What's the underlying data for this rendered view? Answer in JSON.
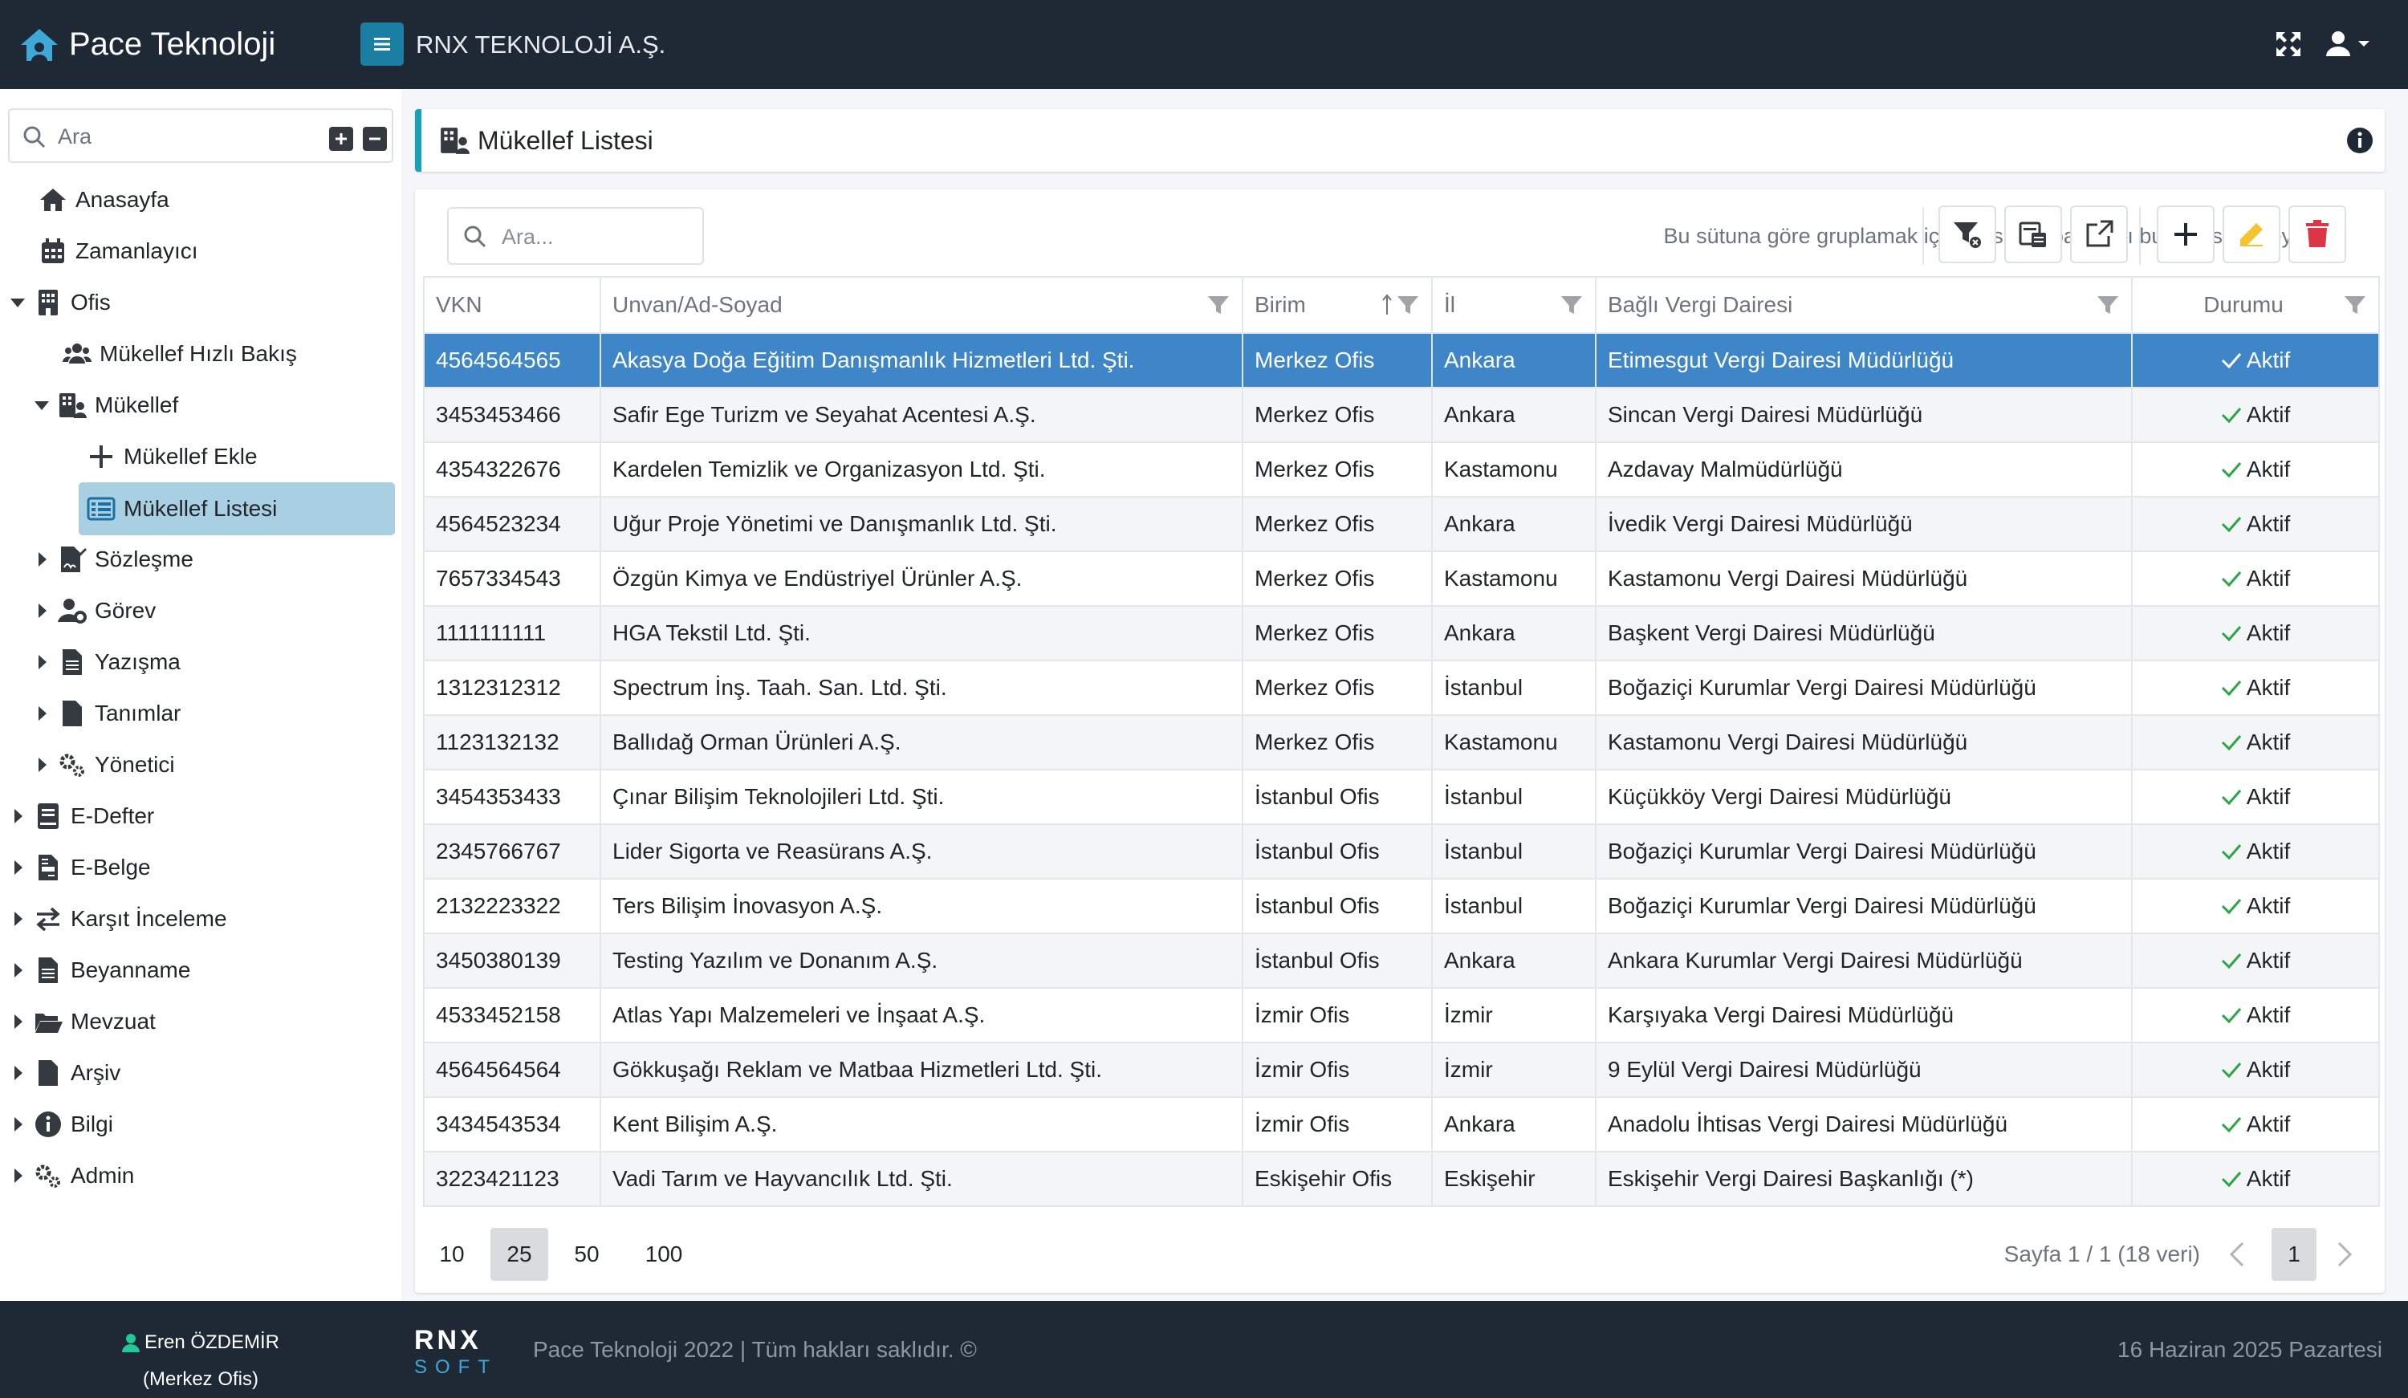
{
  "app": {
    "title": "Pace Teknoloji",
    "company": "RNX TEKNOLOJİ A.Ş."
  },
  "sidebar": {
    "search_placeholder": "Ara",
    "items": [
      {
        "label": "Anasayfa"
      },
      {
        "label": "Zamanlayıcı"
      },
      {
        "label": "Ofis"
      },
      {
        "label": "Mükellef Hızlı Bakış"
      },
      {
        "label": "Mükellef"
      },
      {
        "label": "Mükellef Ekle"
      },
      {
        "label": "Mükellef Listesi"
      },
      {
        "label": "Sözleşme"
      },
      {
        "label": "Görev"
      },
      {
        "label": "Yazışma"
      },
      {
        "label": "Tanımlar"
      },
      {
        "label": "Yönetici"
      },
      {
        "label": "E-Defter"
      },
      {
        "label": "E-Belge"
      },
      {
        "label": "Karşıt İnceleme"
      },
      {
        "label": "Beyanname"
      },
      {
        "label": "Mevzuat"
      },
      {
        "label": "Arşiv"
      },
      {
        "label": "Bilgi"
      },
      {
        "label": "Admin"
      }
    ]
  },
  "user": {
    "name": "Eren ÖZDEMİR",
    "office": "(Merkez Ofis)"
  },
  "footer": {
    "copyright": "Pace Teknoloji 2022 | Tüm hakları saklıdır. ©",
    "date": "16 Haziran 2025 Pazartesi",
    "logo_top": "RNX",
    "logo_bottom": "SOFT"
  },
  "page": {
    "title": "Mükellef Listesi"
  },
  "grid": {
    "search_placeholder": "Ara...",
    "group_hint": "Bu sütuna göre gruplamak için bir sütun başlığını buraya sürükleyin",
    "columns": [
      "VKN",
      "Unvan/Ad-Soyad",
      "Birim",
      "İl",
      "Bağlı Vergi Dairesi",
      "Durumu"
    ],
    "rows": [
      [
        "4564564565",
        "Akasya Doğa Eğitim Danışmanlık Hizmetleri Ltd. Şti.",
        "Merkez Ofis",
        "Ankara",
        "Etimesgut Vergi Dairesi Müdürlüğü",
        "Aktif"
      ],
      [
        "3453453466",
        "Safir Ege Turizm ve Seyahat Acentesi A.Ş.",
        "Merkez Ofis",
        "Ankara",
        "Sincan Vergi Dairesi Müdürlüğü",
        "Aktif"
      ],
      [
        "4354322676",
        "Kardelen Temizlik ve Organizasyon Ltd. Şti.",
        "Merkez Ofis",
        "Kastamonu",
        "Azdavay Malmüdürlüğü",
        "Aktif"
      ],
      [
        "4564523234",
        "Uğur Proje Yönetimi ve Danışmanlık Ltd. Şti.",
        "Merkez Ofis",
        "Ankara",
        "İvedik Vergi Dairesi Müdürlüğü",
        "Aktif"
      ],
      [
        "7657334543",
        "Özgün Kimya ve Endüstriyel Ürünler A.Ş.",
        "Merkez Ofis",
        "Kastamonu",
        "Kastamonu Vergi Dairesi Müdürlüğü",
        "Aktif"
      ],
      [
        "1111111111",
        "HGA Tekstil Ltd. Şti.",
        "Merkez Ofis",
        "Ankara",
        "Başkent Vergi Dairesi Müdürlüğü",
        "Aktif"
      ],
      [
        "1312312312",
        "Spectrum İnş. Taah. San. Ltd. Şti.",
        "Merkez Ofis",
        "İstanbul",
        "Boğaziçi Kurumlar Vergi Dairesi Müdürlüğü",
        "Aktif"
      ],
      [
        "1123132132",
        "Ballıdağ Orman Ürünleri A.Ş.",
        "Merkez Ofis",
        "Kastamonu",
        "Kastamonu Vergi Dairesi Müdürlüğü",
        "Aktif"
      ],
      [
        "3454353433",
        "Çınar Bilişim Teknolojileri Ltd. Şti.",
        "İstanbul Ofis",
        "İstanbul",
        "Küçükköy Vergi Dairesi Müdürlüğü",
        "Aktif"
      ],
      [
        "2345766767",
        "Lider Sigorta ve Reasürans A.Ş.",
        "İstanbul Ofis",
        "İstanbul",
        "Boğaziçi Kurumlar Vergi Dairesi Müdürlüğü",
        "Aktif"
      ],
      [
        "2132223322",
        "Ters Bilişim İnovasyon A.Ş.",
        "İstanbul Ofis",
        "İstanbul",
        "Boğaziçi Kurumlar Vergi Dairesi Müdürlüğü",
        "Aktif"
      ],
      [
        "3450380139",
        "Testing Yazılım ve Donanım A.Ş.",
        "İstanbul Ofis",
        "Ankara",
        "Ankara Kurumlar Vergi Dairesi Müdürlüğü",
        "Aktif"
      ],
      [
        "4533452158",
        "Atlas Yapı Malzemeleri ve İnşaat A.Ş.",
        "İzmir Ofis",
        "İzmir",
        "Karşıyaka Vergi Dairesi Müdürlüğü",
        "Aktif"
      ],
      [
        "4564564564",
        "Gökkuşağı Reklam ve Matbaa Hizmetleri Ltd. Şti.",
        "İzmir Ofis",
        "İzmir",
        "9 Eylül Vergi Dairesi Müdürlüğü",
        "Aktif"
      ],
      [
        "3434543534",
        "Kent Bilişim A.Ş.",
        "İzmir Ofis",
        "Ankara",
        "Anadolu İhtisas Vergi Dairesi Müdürlüğü",
        "Aktif"
      ],
      [
        "3223421123",
        "Vadi Tarım ve Hayvancılık Ltd. Şti.",
        "Eskişehir Ofis",
        "Eskişehir",
        "Eskişehir Vergi Dairesi Başkanlığı (*)",
        "Aktif"
      ]
    ]
  },
  "pager": {
    "sizes": [
      "10",
      "25",
      "50",
      "100"
    ],
    "active_size": "25",
    "info": "Sayfa 1 / 1 (18 veri)",
    "current_page": "1"
  },
  "colors": {
    "topbar": "#1f2936",
    "accent": "#17a2b8",
    "selected_row": "#3f86c9",
    "active_nav": "#a8d0e2",
    "success": "#28a745",
    "danger": "#dc3545",
    "warning": "#f4c430"
  },
  "icons": [
    "home-icon",
    "calendar-icon",
    "building-icon",
    "users-icon",
    "building-user-icon",
    "plus-icon",
    "table-list-icon",
    "signature-icon",
    "user-gear-icon",
    "file-icon",
    "gears-icon",
    "book-icon",
    "file-invoice-icon",
    "arrows-exchange-icon",
    "folder-open-icon",
    "info-icon",
    "expand-icon",
    "user-icon",
    "search-icon",
    "filter-icon",
    "clear-filter-icon",
    "column-chooser-icon",
    "export-icon",
    "edit-icon",
    "trash-icon",
    "check-icon",
    "sort-asc-icon"
  ]
}
